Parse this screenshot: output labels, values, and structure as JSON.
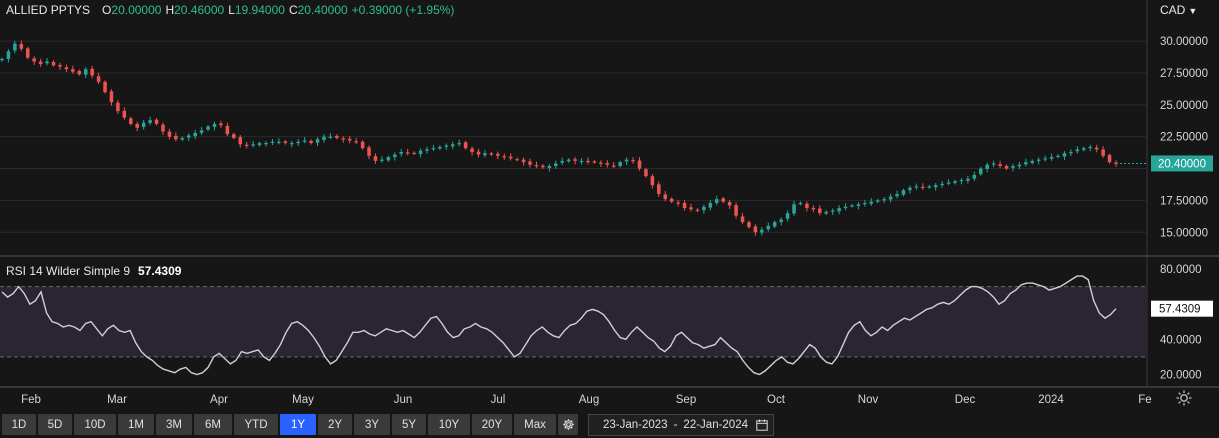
{
  "header": {
    "symbol": "ALLIED PPTYS",
    "open_label": "O",
    "open": "20.00000",
    "high_label": "H",
    "high": "20.46000",
    "low_label": "L",
    "low": "19.94000",
    "close_label": "C",
    "close": "20.40000",
    "change": "+0.39000 (+1.95%)"
  },
  "currency": "CAD",
  "rsi": {
    "label": "RSI 14 Wilder Simple 9",
    "value": "57.4309"
  },
  "price_axis": {
    "ticks": [
      "30.00000",
      "27.50000",
      "25.00000",
      "22.50000",
      "17.50000",
      "15.00000"
    ],
    "current_price_label": "20.40000"
  },
  "rsi_axis": {
    "ticks": [
      "80.0000",
      "40.0000",
      "20.0000"
    ],
    "current_label": "57.4309"
  },
  "time_axis": [
    "Feb",
    "Mar",
    "Apr",
    "May",
    "Jun",
    "Jul",
    "Aug",
    "Sep",
    "Oct",
    "Nov",
    "Dec",
    "2024",
    "Fe"
  ],
  "toolbar": {
    "ranges": [
      "1D",
      "5D",
      "10D",
      "1M",
      "3M",
      "6M",
      "YTD",
      "1Y",
      "2Y",
      "3Y",
      "5Y",
      "10Y",
      "20Y",
      "Max"
    ],
    "active": "1Y",
    "date_from": "23-Jan-2023",
    "date_sep": "-",
    "date_to": "22-Jan-2024"
  },
  "colors": {
    "background": "#161616",
    "up": "#26a69a",
    "down": "#ef5350",
    "rsi_line": "#d0d0d0",
    "rsi_band": "#2a2433",
    "active_range": "#2962ff"
  },
  "chart_data": [
    {
      "type": "candlestick",
      "title": "ALLIED PPTYS",
      "ylim": [
        14.0,
        31.5
      ],
      "x_labels": [
        "Feb",
        "Mar",
        "Apr",
        "May",
        "Jun",
        "Jul",
        "Aug",
        "Sep",
        "Oct",
        "Nov",
        "Dec",
        "2024",
        "Fe"
      ],
      "series": [
        {
          "values": [
            28.6,
            29.2,
            29.8,
            29.4,
            28.7,
            28.4,
            28.2,
            28.4,
            28.1,
            28.0,
            27.8,
            27.6,
            27.4,
            27.8,
            27.3,
            26.8,
            26.0,
            25.2,
            24.5,
            24.0,
            23.5,
            23.2,
            23.6,
            23.8,
            23.5,
            22.9,
            22.5,
            22.3,
            22.4,
            22.6,
            22.8,
            23.0,
            23.3,
            23.5,
            23.4,
            22.7,
            22.4,
            21.9,
            21.8,
            21.9,
            22.0,
            22.0,
            22.1,
            22.1,
            22.0,
            22.0,
            22.1,
            22.2,
            22.0,
            22.3,
            22.5,
            22.5,
            22.4,
            22.3,
            22.2,
            22.1,
            21.6,
            21.0,
            20.6,
            20.7,
            20.9,
            21.1,
            21.3,
            21.2,
            21.2,
            21.4,
            21.5,
            21.6,
            21.7,
            21.8,
            21.9,
            22.0,
            21.6,
            21.3,
            21.1,
            21.2,
            21.1,
            21.0,
            20.9,
            20.8,
            20.7,
            20.5,
            20.3,
            20.2,
            20.1,
            20.2,
            20.4,
            20.6,
            20.7,
            20.6,
            20.6,
            20.5,
            20.5,
            20.4,
            20.3,
            20.2,
            20.5,
            20.7,
            20.6,
            20.0,
            19.4,
            18.7,
            18.0,
            17.6,
            17.4,
            17.3,
            16.9,
            16.8,
            16.7,
            17.0,
            17.3,
            17.6,
            17.4,
            17.1,
            16.3,
            15.8,
            15.4,
            15.0,
            15.2,
            15.5,
            15.8,
            16.0,
            16.5,
            17.2,
            17.3,
            16.9,
            16.8,
            16.5,
            16.6,
            16.7,
            16.9,
            17.0,
            17.1,
            17.2,
            17.3,
            17.4,
            17.5,
            17.6,
            17.8,
            18.0,
            18.3,
            18.5,
            18.6,
            18.5,
            18.6,
            18.7,
            18.8,
            18.9,
            19.0,
            19.1,
            19.2,
            19.5,
            20.0,
            20.3,
            20.4,
            20.2,
            20.0,
            20.2,
            20.3,
            20.5,
            20.6,
            20.7,
            20.8,
            20.9,
            21.0,
            21.2,
            21.3,
            21.5,
            21.6,
            21.7,
            21.5,
            21.0,
            20.5,
            20.4
          ]
        }
      ]
    },
    {
      "type": "line",
      "title": "RSI 14 Wilder Simple 9",
      "ylim": [
        14,
        84
      ],
      "series": [
        {
          "name": "RSI 14 Wilder Simple 9",
          "values": [
            67,
            64,
            66,
            70,
            66,
            60,
            62,
            67,
            55,
            50,
            49,
            47,
            48,
            47,
            45,
            49,
            50,
            46,
            42,
            46,
            48,
            45,
            44,
            45,
            38,
            33,
            30,
            28,
            25,
            23,
            22,
            21,
            23,
            24,
            21,
            20,
            21,
            24,
            30,
            32,
            29,
            26,
            28,
            33,
            32,
            33,
            34,
            30,
            28,
            32,
            37,
            44,
            49,
            50,
            48,
            45,
            41,
            36,
            30,
            26,
            28,
            33,
            38,
            44,
            44,
            45,
            43,
            42,
            44,
            46,
            45,
            44,
            45,
            43,
            41,
            44,
            48,
            52,
            53,
            49,
            44,
            41,
            42,
            46,
            47,
            49,
            47,
            46,
            44,
            41,
            38,
            34,
            30,
            32,
            37,
            42,
            45,
            47,
            44,
            42,
            41,
            45,
            48,
            49,
            52,
            56,
            57,
            56,
            54,
            50,
            45,
            41,
            40,
            44,
            47,
            44,
            41,
            39,
            35,
            33,
            36,
            42,
            44,
            41,
            38,
            37,
            35,
            36,
            37,
            41,
            38,
            35,
            33,
            28,
            24,
            21,
            20,
            22,
            25,
            28,
            30,
            27,
            26,
            29,
            33,
            37,
            35,
            30,
            27,
            26,
            30,
            37,
            44,
            48,
            50,
            45,
            42,
            44,
            47,
            45,
            48,
            50,
            52,
            51,
            53,
            55,
            57,
            58,
            60,
            61,
            60,
            62,
            65,
            68,
            70,
            70,
            69,
            67,
            64,
            60,
            62,
            66,
            68,
            71,
            72,
            72,
            71,
            70,
            68,
            69,
            70,
            72,
            74,
            76,
            76,
            74,
            62,
            55,
            52,
            54,
            57.4
          ]
        }
      ],
      "reference_lines": [
        70,
        30
      ]
    }
  ]
}
